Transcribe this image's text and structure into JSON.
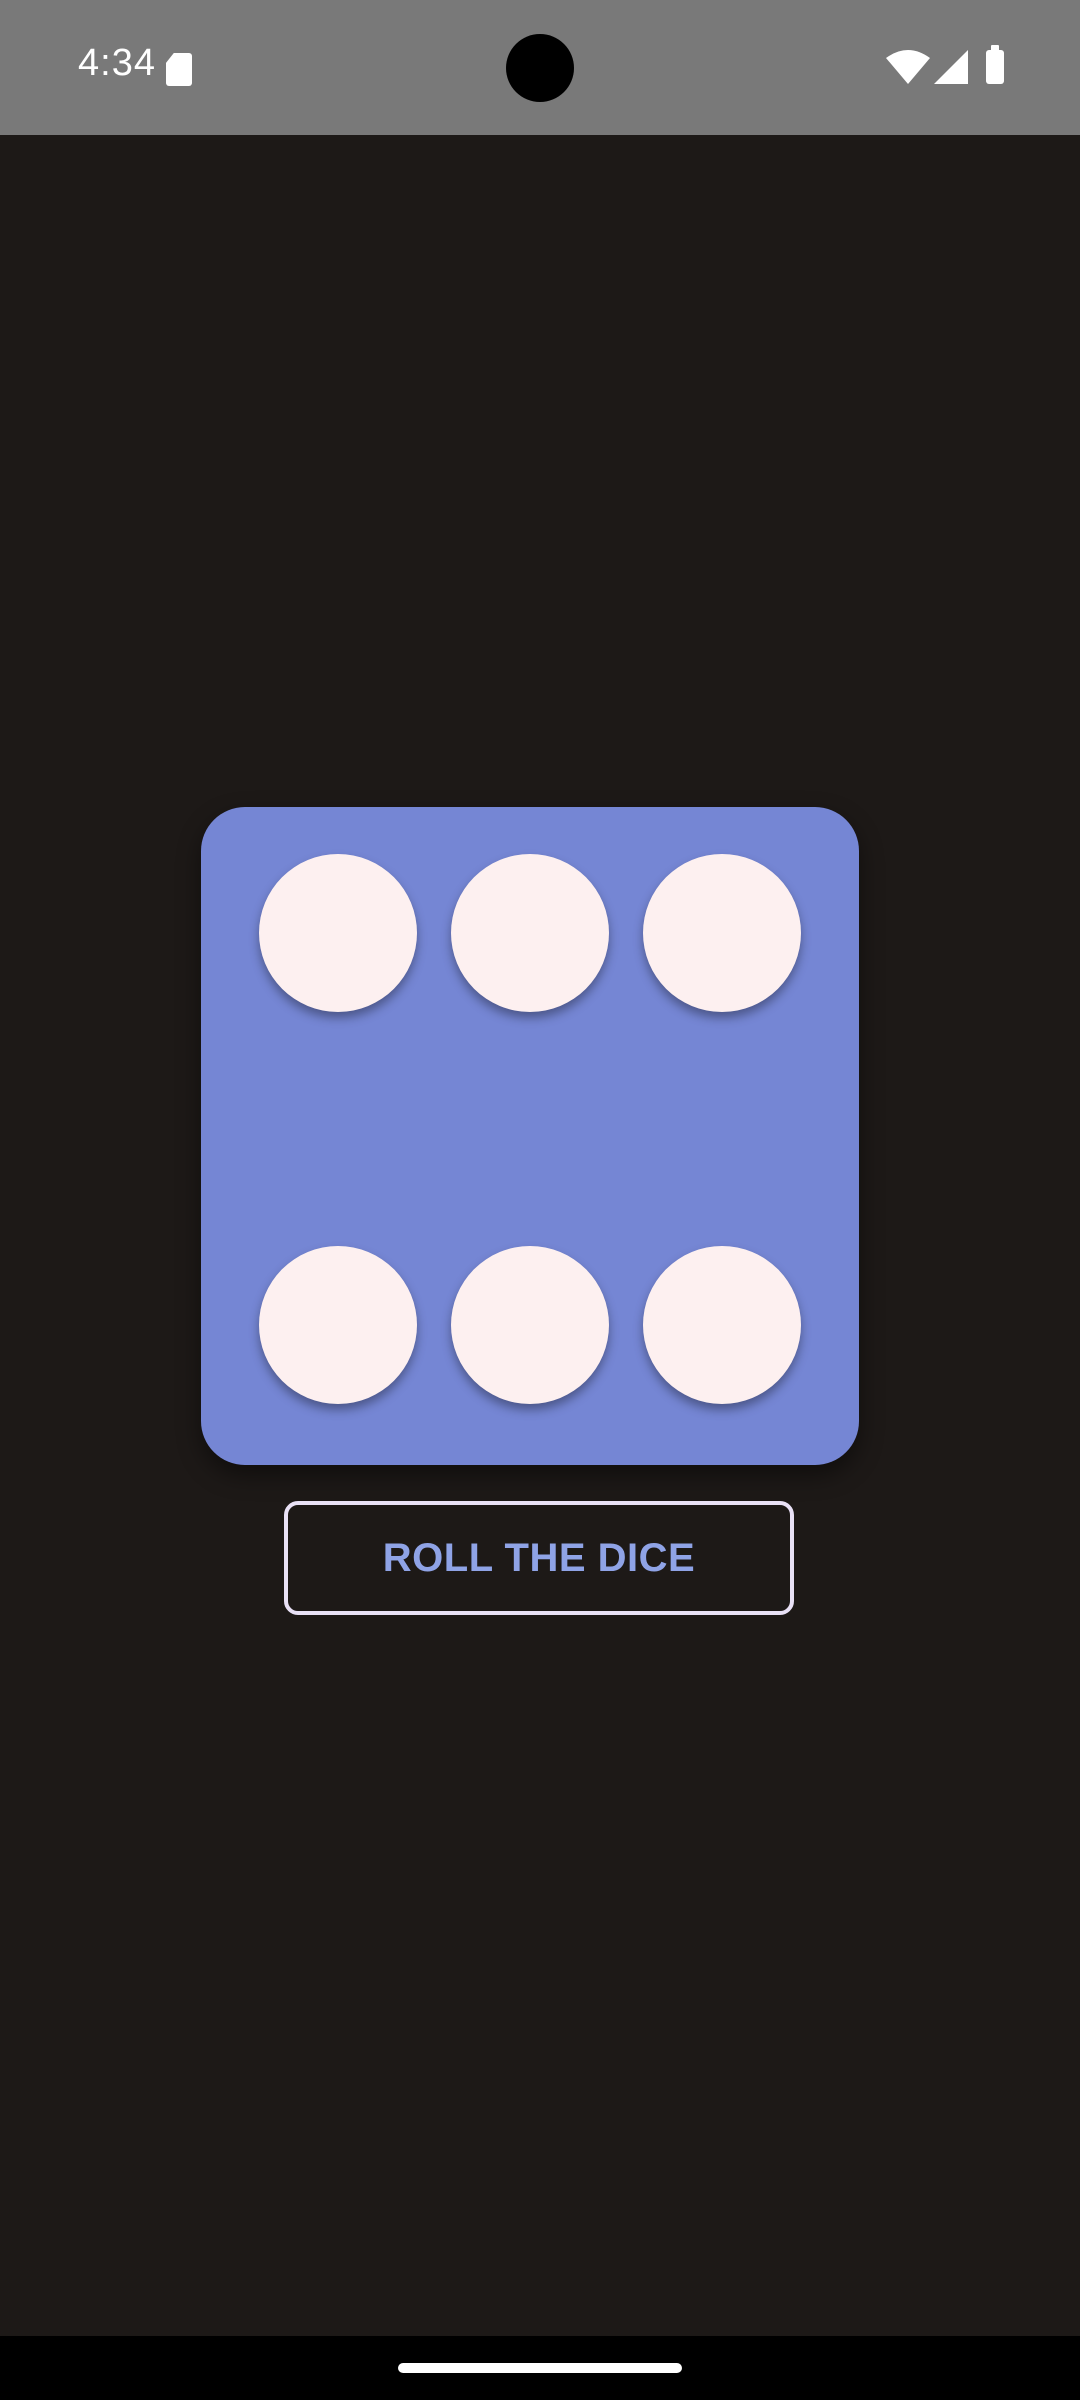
{
  "status_bar": {
    "time": "4:34",
    "icons": [
      "sd-card-icon",
      "wifi-icon",
      "signal-icon",
      "battery-icon"
    ]
  },
  "dice": {
    "face_value": 6,
    "color": "#7586d4",
    "pip_color": "#fdf0f0"
  },
  "roll_button": {
    "label": "ROLL THE DICE",
    "text_color": "#8fa3e6",
    "border_color": "#e9e1f6"
  },
  "theme": {
    "background": "#1d1917",
    "status_bar_bg": "#797979"
  }
}
